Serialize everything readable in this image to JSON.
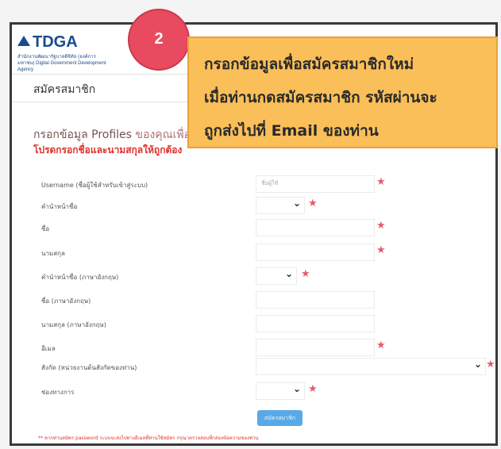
{
  "logo": {
    "text": "TDGA",
    "subtitle": "สำนักงานพัฒนารัฐบาลดิจิทัล (องค์การมหาชน) Digital Government Development Agency"
  },
  "page": {
    "title": "สมัครสมาชิก",
    "section_heading": "กรอกข้อมูล Profiles",
    "section_heading_rest": "ของคุณเพื่อ",
    "notice": "โปรดกรอกชื่อและนามสกุลให้ถูกต้อง"
  },
  "annotation": {
    "step_number": "2",
    "callout_lines": [
      "กรอกข้อมูลเพื่อสมัครสมาชิกใหม่",
      "เมื่อท่านกดสมัครสมาชิก รหัสผ่านจะ",
      "ถูกส่งไปที่ Email ของท่าน"
    ]
  },
  "form": {
    "rows": [
      {
        "label": "Username (ชื่อผู้ใช้สำหรับเข้าสู่ระบบ)",
        "placeholder": "ชื่อผู้ใช้",
        "kind": "text",
        "required": true
      },
      {
        "label": "คำนำหน้าชื่อ",
        "kind": "select",
        "required": true
      },
      {
        "label": "ชื่อ",
        "kind": "text",
        "required": true
      },
      {
        "label": "นามสกุล",
        "kind": "text",
        "required": true
      },
      {
        "label": "คำนำหน้าชื่อ (ภาษาอังกฤษ)",
        "kind": "select",
        "required": true
      },
      {
        "label": "ชื่อ (ภาษาอังกฤษ)",
        "kind": "text",
        "required": false
      },
      {
        "label": "นามสกุล (ภาษาอังกฤษ)",
        "kind": "text",
        "required": false
      },
      {
        "label": "อีเมล",
        "kind": "text",
        "required": true
      },
      {
        "label": "สังกัด (หน่วยงานต้นสังกัดของท่าน)",
        "kind": "select-wide",
        "required": true
      },
      {
        "label": "ช่องทางการ",
        "kind": "select",
        "required": true
      }
    ],
    "submit_label": "สมัครสมาชิก",
    "footer_note": "** หากท่านสมัคร password ระบบจะส่งไปทางอีเมลที่ท่านใช้สมัคร กรุณาตรวจสอบที่กล่องข้อความของท่าน"
  },
  "colors": {
    "accent_red": "#e0302a",
    "callout_bg": "#fbbf59",
    "badge": "#e84a5f",
    "submit": "#5aa9e6",
    "required_star": "#e25c6e"
  },
  "icons": {
    "required": "star-icon",
    "dropdown": "chevron-down-icon"
  }
}
